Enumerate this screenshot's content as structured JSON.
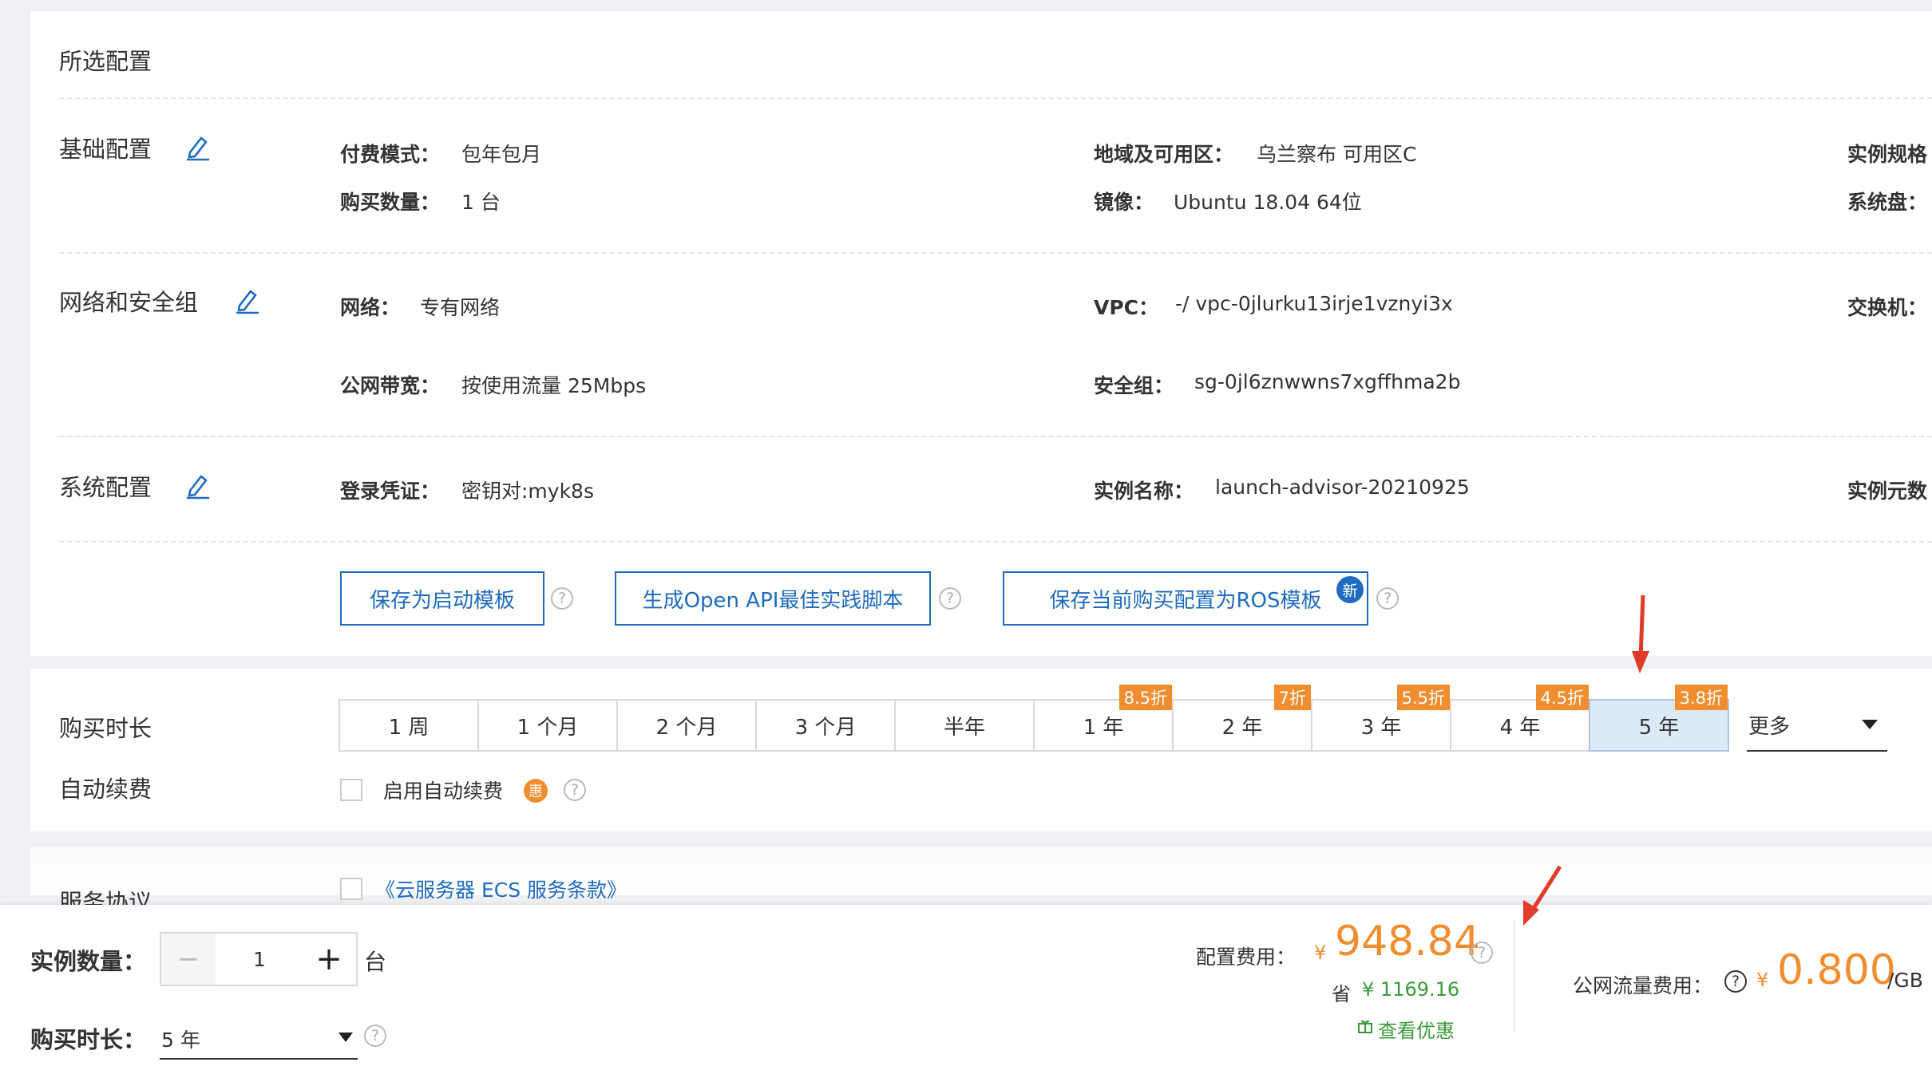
{
  "selected_config": {
    "title": "所选配置",
    "basic": {
      "title": "基础配置",
      "pay_mode_label": "付费模式：",
      "pay_mode_value": "包年包月",
      "region_label": "地域及可用区：",
      "region_value": "乌兰察布 可用区C",
      "instance_spec_label": "实例规格",
      "quantity_label": "购买数量：",
      "quantity_value": "1 台",
      "image_label": "镜像：",
      "image_value": "Ubuntu 18.04 64位",
      "system_disk_label": "系统盘："
    },
    "network": {
      "title": "网络和安全组",
      "network_label": "网络：",
      "network_value": "专有网络",
      "vpc_label": "VPC：",
      "vpc_value": "-/ vpc-0jlurku13irje1vznyi3x",
      "switch_label": "交换机：",
      "bandwidth_label": "公网带宽：",
      "bandwidth_value": "按使用流量 25Mbps",
      "security_group_label": "安全组：",
      "security_group_value": "sg-0jl6znwwns7xgffhma2b"
    },
    "system": {
      "title": "系统配置",
      "login_label": "登录凭证：",
      "login_value": "密钥对:myk8s",
      "instance_name_label": "实例名称：",
      "instance_name_value": "launch-advisor-20210925",
      "metadata_label": "实例元数"
    },
    "actions": {
      "save_template": "保存为启动模板",
      "gen_api": "生成Open API最佳实践脚本",
      "save_ros": "保存当前购买配置为ROS模板",
      "new_badge": "新"
    }
  },
  "purchase": {
    "duration_title": "购买时长",
    "auto_renew_title": "自动续费",
    "periods": [
      {
        "label": "1 周",
        "discount": ""
      },
      {
        "label": "1 个月",
        "discount": ""
      },
      {
        "label": "2 个月",
        "discount": ""
      },
      {
        "label": "3 个月",
        "discount": ""
      },
      {
        "label": "半年",
        "discount": ""
      },
      {
        "label": "1 年",
        "discount": "8.5折"
      },
      {
        "label": "2 年",
        "discount": "7折"
      },
      {
        "label": "3 年",
        "discount": "5.5折"
      },
      {
        "label": "4 年",
        "discount": "4.5折"
      },
      {
        "label": "5 年",
        "discount": "3.8折",
        "selected": true
      }
    ],
    "more_label": "更多",
    "auto_renew_label": "启用自动续费",
    "auto_renew_badge": "惠"
  },
  "agreement": {
    "title": "服务协议",
    "link": "《云服务器 ECS 服务条款》"
  },
  "footer": {
    "quantity_label": "实例数量：",
    "quantity_value": "1",
    "quantity_unit": "台",
    "minus": "−",
    "plus": "+",
    "duration_label": "购买时长：",
    "duration_value": "5 年",
    "config_fee_label": "配置费用：",
    "currency": "¥",
    "config_fee": "948.84",
    "save_prefix": "省",
    "save_amount": "¥ 1169.16",
    "view_discount": "查看优惠",
    "traffic_fee_label": "公网流量费用：",
    "traffic_fee": "0.800",
    "traffic_unit": "/GB"
  },
  "colors": {
    "primary": "#1f6bbf",
    "orange": "#f08d2f",
    "price": "#f08d2f",
    "save_green": "#3a9a3a",
    "arrow_red": "#e03a2a"
  }
}
